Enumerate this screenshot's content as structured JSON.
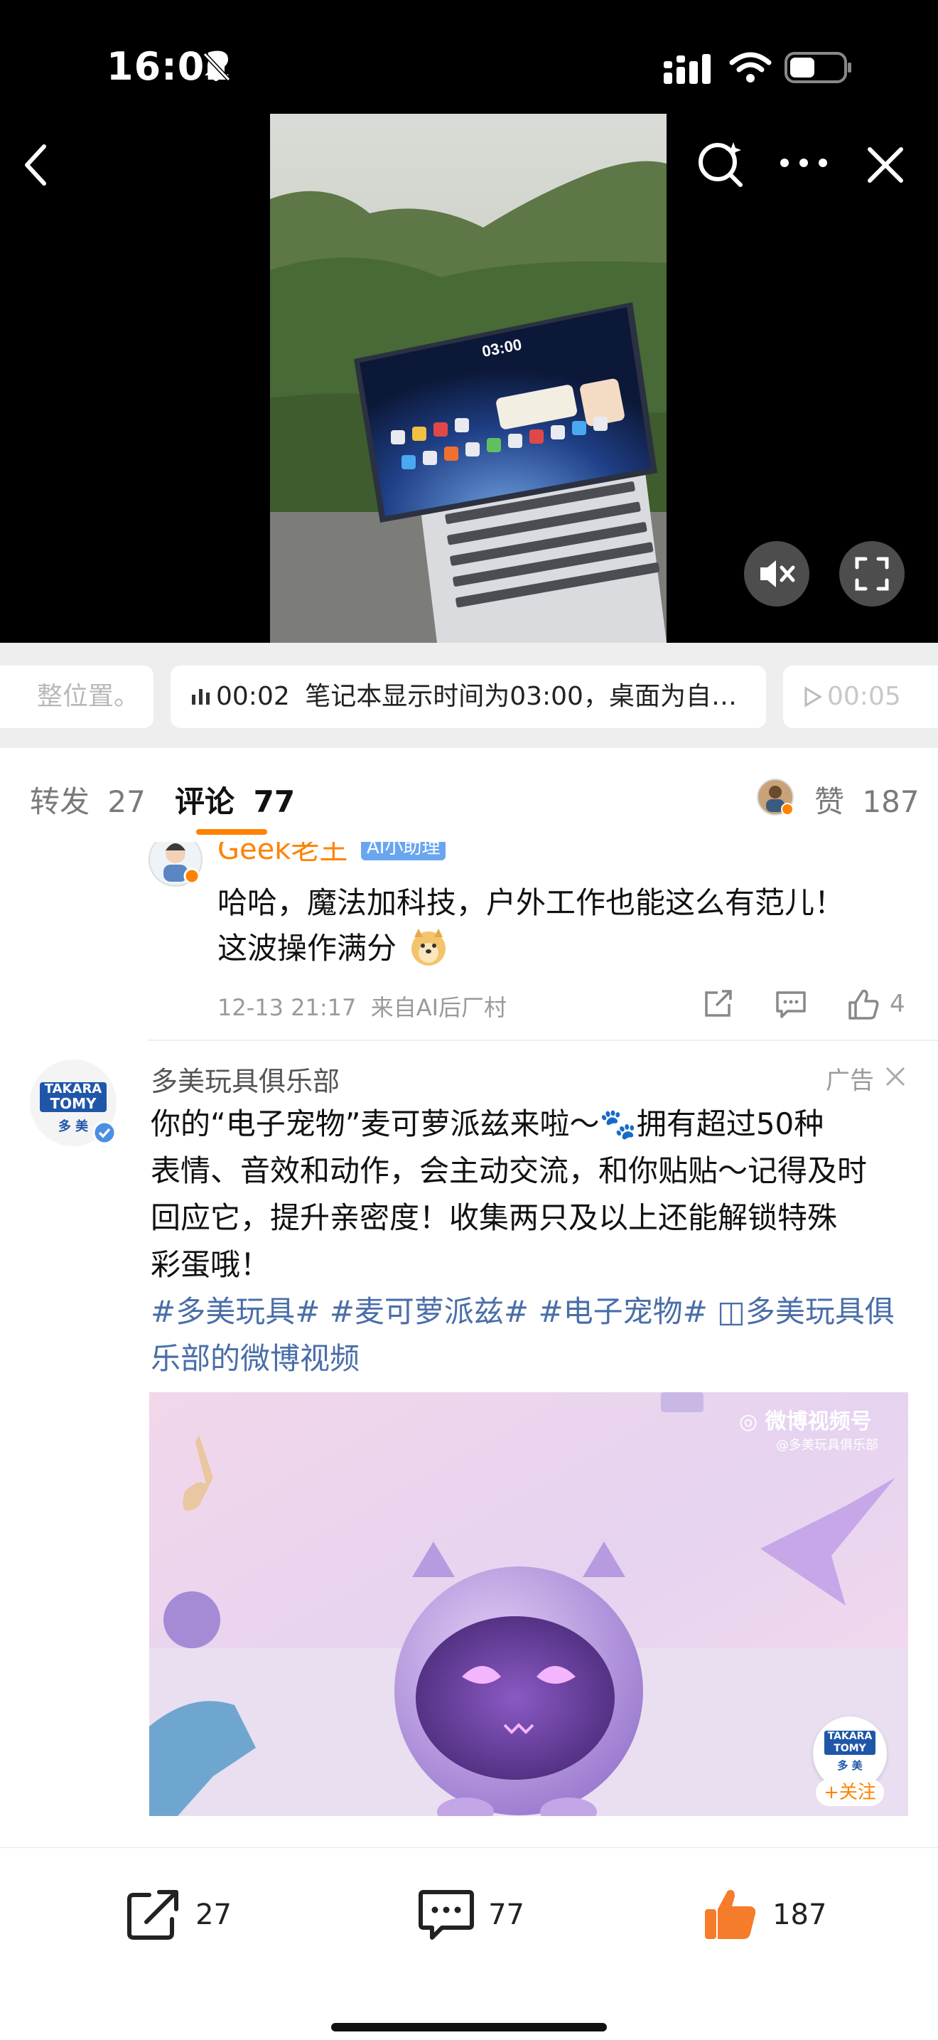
{
  "status_bar": {
    "time": "16:02"
  },
  "video": {
    "screen_time": "03:00",
    "subtitles": [
      {
        "time": "",
        "text": "整位置。"
      },
      {
        "time": "00:02",
        "text": "笔记本显示时间为03:00，桌面为自…"
      },
      {
        "time": "00:05",
        "text": ""
      }
    ]
  },
  "tabs": {
    "repost_label": "转发",
    "repost_count": "27",
    "comment_label": "评论",
    "comment_count": "77",
    "like_label": "赞",
    "like_count": "187"
  },
  "comment": {
    "username": "Geek老王",
    "badge": "AI小助理",
    "line1": "哈哈，魔法加科技，户外工作也能这么有范儿！",
    "line2": "这波操作满分",
    "meta": "12-13 21:17  来自AI后厂村",
    "like_count": "4"
  },
  "ad": {
    "name": "多美玩具俱乐部",
    "ad_label": "广告",
    "logo_line1": "TAKARA",
    "logo_line2": "TOMY",
    "logo_line3": "多 美",
    "line1": "你的“电子宠物”麦可萝派兹来啦～🐾拥有超过50种",
    "line2": "表情、音效和动作，会主动交流，和你贴贴～记得及时",
    "line3": "回应它，提升亲密度！收集两只及以上还能解锁特殊",
    "line4": "彩蛋哦！",
    "tags_line1": "#多美玩具# #麦可萝派兹# #电子宠物# ◫多美玩具俱",
    "tags_line2": "乐部的微博视频",
    "watermark": "微博视频号",
    "watermark_sub": "@多美玩具俱乐部",
    "follow": "+关注"
  },
  "bottom_bar": {
    "repost": "27",
    "comment": "77",
    "like": "187"
  },
  "colors": {
    "accent": "#ff8200",
    "tag_blue": "#4a6ea8",
    "like_orange": "#f57c2a"
  }
}
